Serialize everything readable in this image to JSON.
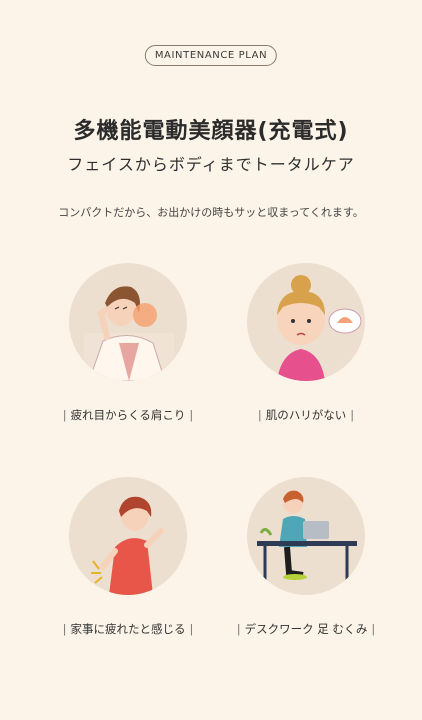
{
  "badge": "MAINTENANCE PLAN",
  "title": "多機能電動美顔器(充電式)",
  "subtitle": "フェイスからボディまでトータルケア",
  "description": "コンパクトだから、お出かけの時もサッと収まってくれます。",
  "bar": "|",
  "items": [
    {
      "caption": "疲れ目からくる肩こり",
      "icon": "shoulder-pain-illustration"
    },
    {
      "caption": "肌のハリがない",
      "icon": "skin-concern-illustration"
    },
    {
      "caption": "家事に疲れたと感じる",
      "icon": "back-pain-illustration"
    },
    {
      "caption": "デスクワーク 足 むくみ",
      "icon": "desk-work-illustration"
    }
  ],
  "colors": {
    "background": "#fcf4e8",
    "circle": "#ecdfcf",
    "accent": "#e8564a"
  }
}
